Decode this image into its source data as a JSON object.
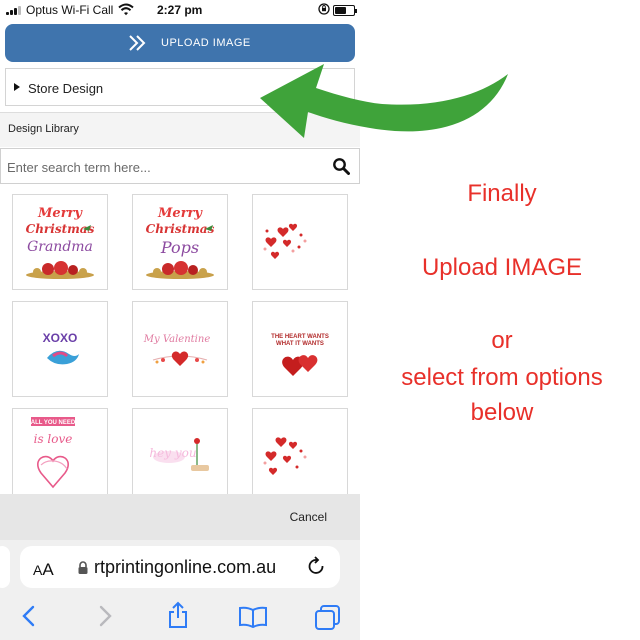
{
  "status_bar": {
    "carrier": "Optus Wi-Fi Call",
    "time": "2:27 pm"
  },
  "upload_button": {
    "label": "UPLOAD IMAGE"
  },
  "store_design": {
    "label": "Store Design"
  },
  "design_library": {
    "heading": "Design Library",
    "search_placeholder": "Enter search term here..."
  },
  "tiles": [
    {
      "line1": "Merry",
      "line2": "Christmas",
      "line3": "Grandma"
    },
    {
      "line1": "Merry",
      "line2": "Christmas",
      "line3": "Pops"
    },
    {
      "line1": ""
    },
    {
      "line1": "XOXO"
    },
    {
      "line1": "My Valentine"
    },
    {
      "line1": "THE HEART WANTS",
      "line2": "WHAT IT WANTS"
    },
    {
      "line1": "ALL YOU NEED",
      "line2": "is love"
    },
    {
      "line1": "hey you"
    },
    {
      "line1": ""
    }
  ],
  "action_sheet": {
    "cancel_label": "Cancel"
  },
  "browser": {
    "text_size_label_small": "A",
    "text_size_label_large": "A",
    "url": "rtprintingonline.com.au"
  },
  "annotation": {
    "line1": "Finally",
    "line2": "Upload IMAGE",
    "line3": "or",
    "line4": "select from options",
    "line5": "below"
  },
  "colors": {
    "upload_button": "#3f74ad",
    "arrow": "#3fa33a",
    "annotation_text": "#e8302a",
    "ios_blue": "#2f7cf6"
  },
  "icons": [
    "signal-icon",
    "wifi-icon",
    "orientation-lock-icon",
    "battery-icon",
    "double-chevron-icon",
    "disclosure-triangle-icon",
    "search-icon",
    "lock-icon",
    "reload-icon",
    "back-icon",
    "forward-icon",
    "share-icon",
    "bookmarks-icon",
    "tabs-icon"
  ]
}
